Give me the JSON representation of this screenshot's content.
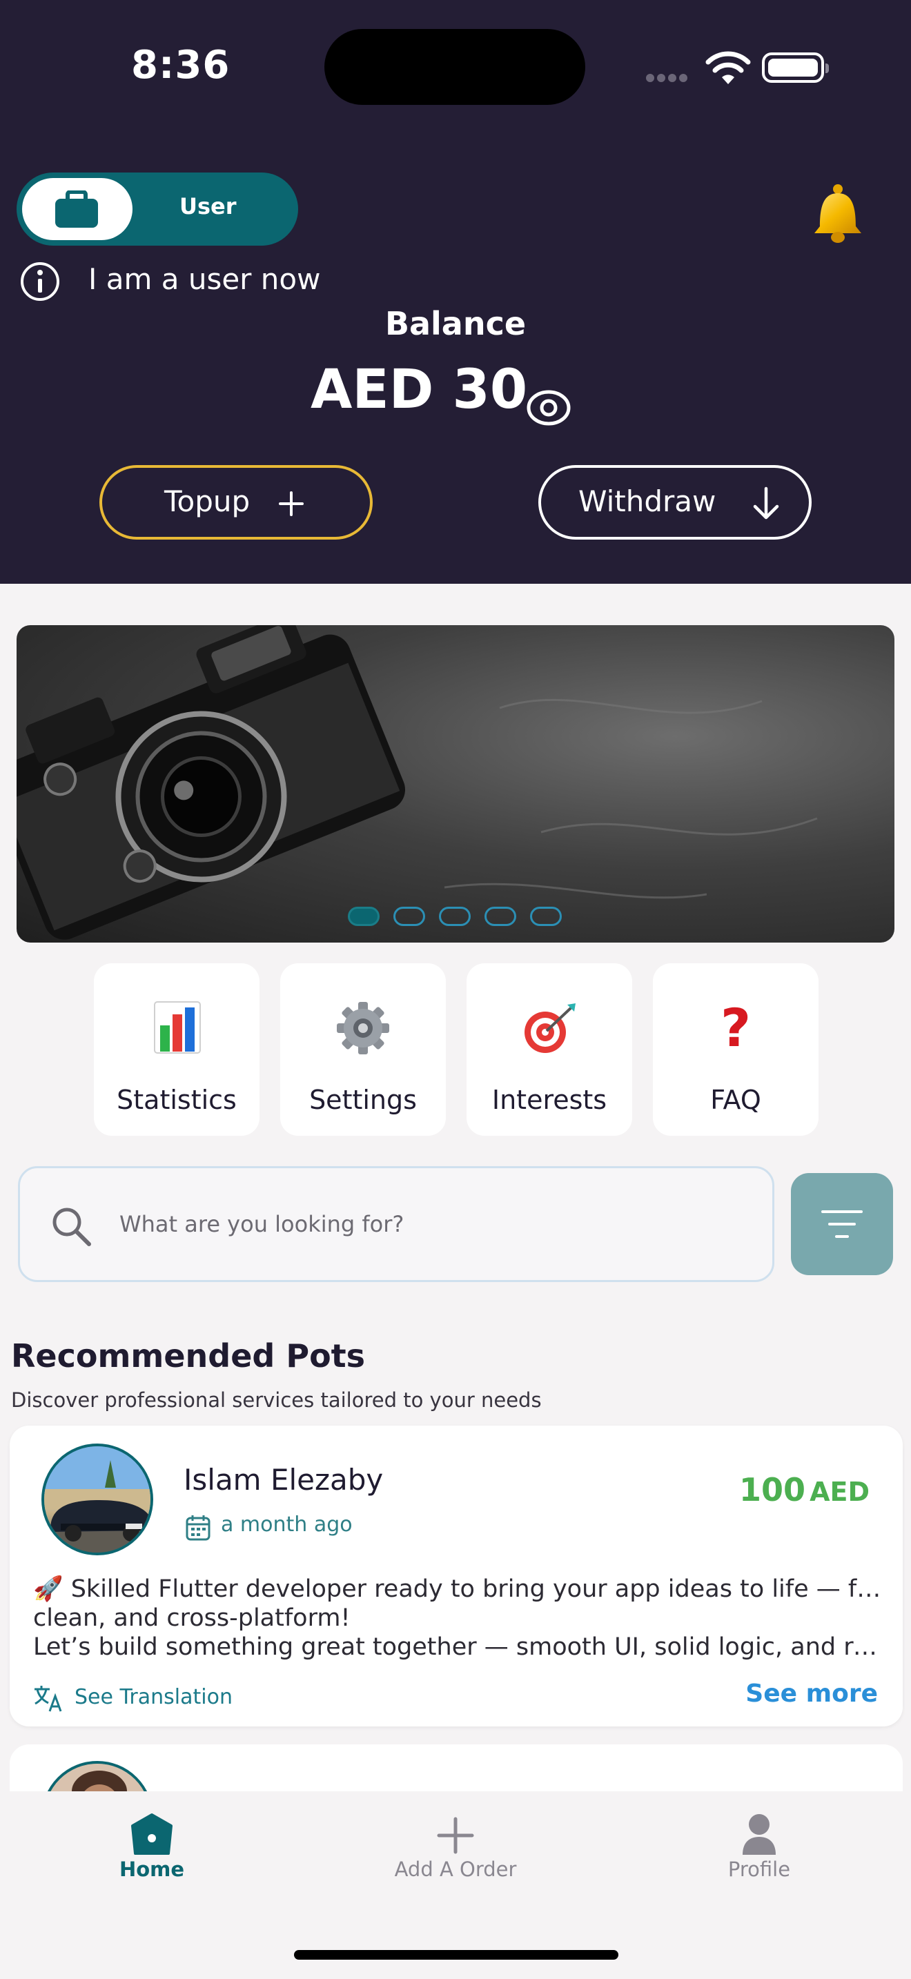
{
  "status_bar": {
    "time": "8:36"
  },
  "header": {
    "role_toggle": {
      "label": "User",
      "icon": "briefcase-icon"
    },
    "notification_icon": "bell-icon",
    "info_text": "I am a user now",
    "balance_title": "Balance",
    "balance_amount": "AED 30",
    "topup_label": "Topup",
    "withdraw_label": "Withdraw",
    "colors": {
      "background": "#241e35",
      "accent": "#0b6670",
      "topup_border": "#e8b936"
    }
  },
  "banner": {
    "slides_count": 5,
    "active_slide": 1
  },
  "quick_actions": [
    {
      "label": "Statistics",
      "icon": "bar-chart-icon"
    },
    {
      "label": "Settings",
      "icon": "gear-icon"
    },
    {
      "label": "Interests",
      "icon": "target-icon"
    },
    {
      "label": "FAQ",
      "icon": "question-mark-icon"
    }
  ],
  "search": {
    "placeholder": "What are you looking for?"
  },
  "recommended": {
    "title": "Recommended Pots",
    "subtitle": "Discover professional services tailored to your needs",
    "cards": [
      {
        "name": "Islam Elezaby",
        "time": "a month ago",
        "price": "100",
        "currency": "AED",
        "desc_line1": "🚀  Skilled Flutter developer ready to bring your app ideas to life — fast,",
        "desc_line2": "clean, and cross-platform!",
        "desc_line3": "Let’s build something great together — smooth UI, solid logic, and real impact.",
        "see_translation": "See Translation",
        "see_more": "See more"
      }
    ]
  },
  "bottom_nav": {
    "items": [
      {
        "label": "Home",
        "icon": "home-icon",
        "active": true
      },
      {
        "label": "Add A Order",
        "icon": "plus-icon",
        "active": false
      },
      {
        "label": "Profile",
        "icon": "person-icon",
        "active": false
      }
    ]
  }
}
